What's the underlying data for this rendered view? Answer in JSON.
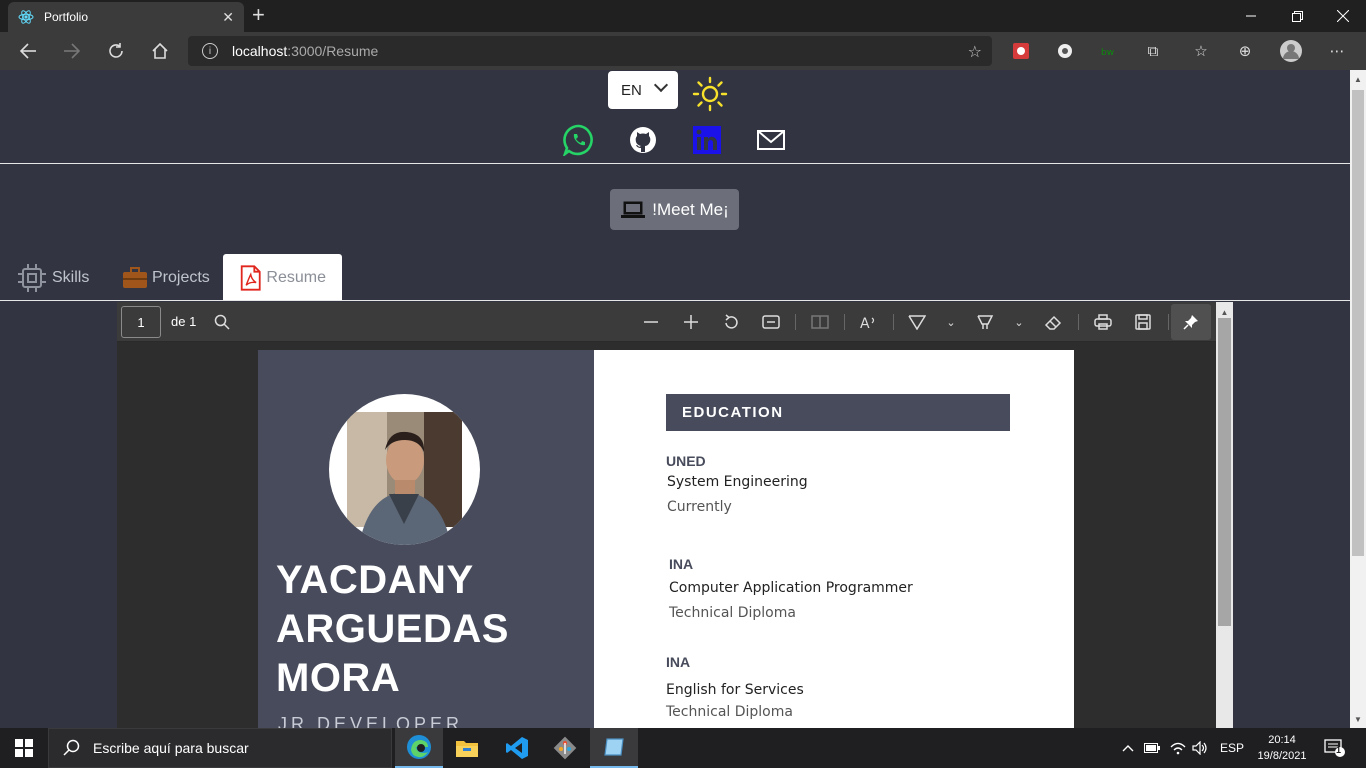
{
  "browser": {
    "tab_title": "Portfolio",
    "tab_close": "✕",
    "new_tab": "+",
    "url_host": "localhost",
    "url_path": ":3000/Resume"
  },
  "page": {
    "language": "EN",
    "meet_button": "!Meet Me¡",
    "tabs": [
      {
        "label": "Skills"
      },
      {
        "label": "Projects"
      },
      {
        "label": "Resume"
      }
    ]
  },
  "pdf_viewer": {
    "page_number": "1",
    "page_of": "de 1"
  },
  "resume": {
    "name_line1": "YACDANY",
    "name_line2": "ARGUEDAS",
    "name_line3": "MORA",
    "role": "JR DEVELOPER",
    "education_heading": "EDUCATION",
    "education": [
      {
        "institution": "UNED",
        "degree": "System Engineering",
        "detail": "Currently"
      },
      {
        "institution": "INA",
        "degree": "Computer Application Programmer",
        "detail": "Technical Diploma"
      },
      {
        "institution": "INA",
        "degree": "English for Services",
        "detail": "Technical Diploma"
      }
    ]
  },
  "taskbar": {
    "search_placeholder": "Escribe aquí para buscar",
    "language": "ESP",
    "time": "20:14",
    "date": "19/8/2021",
    "notification_count": "1"
  },
  "colors": {
    "page_bg": "#323541",
    "resume_sidebar": "#474b5b",
    "sun": "#f7e12b",
    "whatsapp": "#25d366",
    "linkedin": "#1a12e8"
  },
  "icons": [
    "react-icon",
    "whatsapp-icon",
    "github-icon",
    "linkedin-icon",
    "mail-icon",
    "laptop-icon",
    "chip-icon",
    "briefcase-icon",
    "pdf-icon",
    "sun-icon"
  ]
}
